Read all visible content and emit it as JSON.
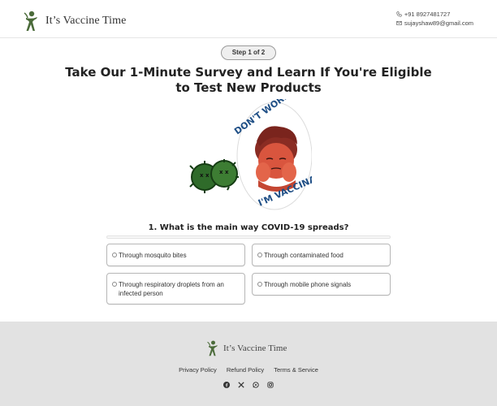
{
  "header": {
    "brand_name": "It’s Vaccine Time",
    "phone": "+91 8927481727",
    "email": "sujayshaw89@gmail.com"
  },
  "step": {
    "label": "Step 1 of 2"
  },
  "title": "Take Our 1-Minute Survey and Learn If You're Eligible to Test New Products",
  "hero": {
    "banner_top": "DON'T WORRY",
    "banner_bottom": "I'M VACCINATED"
  },
  "question": {
    "text": "1. What is the main way COVID-19 spreads?",
    "options": [
      "Through mosquito bites",
      "Through contaminated food",
      "Through respiratory droplets from an infected person",
      "Through mobile phone signals"
    ]
  },
  "footer": {
    "brand_name": "It’s Vaccine Time",
    "links": [
      "Privacy Policy",
      "Refund Policy",
      "Terms & Service"
    ],
    "social_icons": [
      "facebook-icon",
      "x-icon",
      "whatsapp-icon",
      "instagram-icon"
    ]
  },
  "colors": {
    "logo_green": "#4b6b3a",
    "footer_bg": "#e2e2e2",
    "option_border": "#b7b7b7"
  }
}
